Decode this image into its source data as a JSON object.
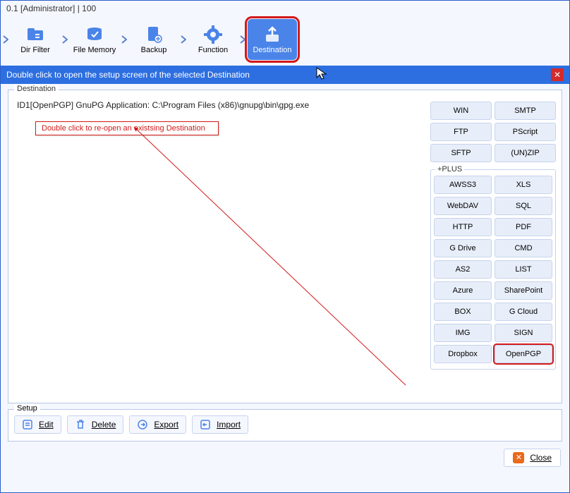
{
  "titlebar": "0.1 [Administrator]    |    100",
  "toolbar": {
    "items": [
      {
        "label": "Dir Filter"
      },
      {
        "label": "File Memory"
      },
      {
        "label": "Backup"
      },
      {
        "label": "Function"
      },
      {
        "label": "Destination"
      }
    ]
  },
  "subheader": "Double click to open the setup screen of the selected Destination",
  "destination": {
    "legend": "Destination",
    "row": "ID1[OpenPGP] GnuPG Application: C:\\Program Files (x86)\\gnupg\\bin\\gpg.exe",
    "tip": "Double click to re-open an existsing Destination"
  },
  "side": {
    "top": [
      "WIN",
      "SMTP",
      "FTP",
      "PScript",
      "SFTP",
      "(UN)ZIP"
    ],
    "plus_legend": "+PLUS",
    "plus": [
      "AWSS3",
      "XLS",
      "WebDAV",
      "SQL",
      "HTTP",
      "PDF",
      "G Drive",
      "CMD",
      "AS2",
      "LIST",
      "Azure",
      "SharePoint",
      "BOX",
      "G Cloud",
      "IMG",
      "SIGN",
      "Dropbox",
      "OpenPGP"
    ]
  },
  "setup": {
    "legend": "Setup",
    "buttons": {
      "edit": "Edit",
      "delete": "Delete",
      "export": "Export",
      "import": "Import"
    }
  },
  "footer": {
    "close": "Close"
  }
}
